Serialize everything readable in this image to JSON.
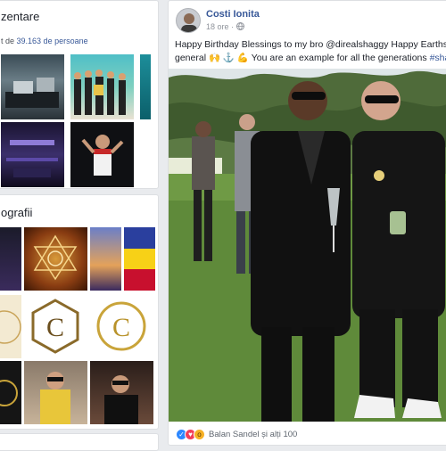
{
  "left": {
    "featured": {
      "title": "zentare",
      "subtitle_prefix": "t de",
      "subtitle_count": "39.163 de persoane"
    },
    "photos": {
      "title": "ografii"
    }
  },
  "post": {
    "author": "Costi Ionita",
    "time": "18 ore",
    "privacy_dot": "·",
    "text_line1": "Happy Birthday Blessings to my bro @direalshaggy Happy Earthstrong",
    "text_line2": "general 🙌 ⚓ 💪 You are an example for all the generations",
    "hashtag": "#shaggy",
    "reactions_text": "Balan Sandel și alți 100"
  },
  "colors": {
    "link": "#385898",
    "like": "#2d88ff",
    "love": "#f33e58",
    "wow": "#f7b125"
  },
  "icons": [
    "globe-icon",
    "like-reaction-icon",
    "love-reaction-icon",
    "wow-reaction-icon"
  ]
}
